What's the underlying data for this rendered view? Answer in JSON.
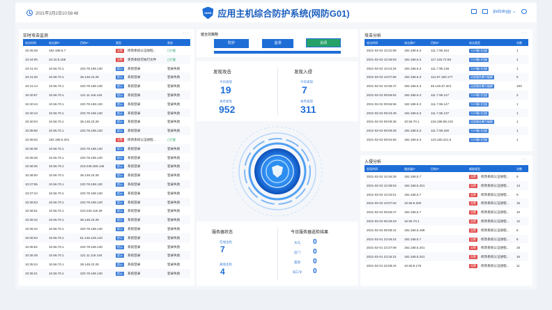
{
  "header": {
    "datetime": "2021年2月2日10:58:48",
    "title": "应用主机综合防护系统(网防G01)",
    "logo_text": "IAMS",
    "user": "jisdzdcyjy"
  },
  "realtime": {
    "title": "实时攻击监测",
    "more": "···",
    "columns": [
      "攻击时间",
      "攻击源IP",
      "目的IP",
      "类型",
      "状态"
    ],
    "rows": [
      {
        "time": "10:45:28",
        "src": "192.168.5.7",
        "dst": "",
        "tag": "告警",
        "tag_color": "red",
        "type": "修改系统认证进程...",
        "status": "已拦截",
        "ok": true
      },
      {
        "time": "10:44:06",
        "src": "10.34.8.156",
        "dst": "",
        "tag": "告警",
        "tag_color": "red",
        "type": "更改系统可执行文件",
        "status": "已拦截",
        "ok": true
      },
      {
        "time": "10:41:44",
        "src": "10.56.70.1",
        "dst": "220.78.169.130",
        "tag": "提示",
        "tag_color": "blue",
        "type": "系统登录",
        "status": "登录失败",
        "ok": false
      },
      {
        "time": "10:41:26",
        "src": "10.56.70.1",
        "dst": "36.148.23.28",
        "tag": "提示",
        "tag_color": "blue",
        "type": "系统登录",
        "status": "登录失败",
        "ok": false
      },
      {
        "time": "10:41:14",
        "src": "10.56.70.1",
        "dst": "220.78.169.130",
        "tag": "提示",
        "tag_color": "blue",
        "type": "系统登录",
        "status": "登录失败",
        "ok": false
      },
      {
        "time": "10:40:57",
        "src": "10.56.70.1",
        "dst": "121.11.116.145",
        "tag": "提示",
        "tag_color": "blue",
        "type": "系统登录",
        "status": "登录失败",
        "ok": false
      },
      {
        "time": "10:40:44",
        "src": "10.56.70.1",
        "dst": "220.78.169.130",
        "tag": "提示",
        "tag_color": "blue",
        "type": "系统登录",
        "status": "登录失败",
        "ok": false
      },
      {
        "time": "10:40:13",
        "src": "10.56.70.1",
        "dst": "220.78.169.130",
        "tag": "提示",
        "tag_color": "blue",
        "type": "系统登录",
        "status": "登录失败",
        "ok": false
      },
      {
        "time": "10:40:04",
        "src": "10.56.70.1",
        "dst": "36.148.23.28",
        "tag": "提示",
        "tag_color": "blue",
        "type": "系统登录",
        "status": "登录失败",
        "ok": false
      },
      {
        "time": "10:38:56",
        "src": "10.56.70.1",
        "dst": "220.78.169.130",
        "tag": "提示",
        "tag_color": "blue",
        "type": "系统登录",
        "status": "登录失败",
        "ok": false
      },
      {
        "time": "10:38:53",
        "src": "192.168.5.201",
        "dst": "",
        "tag": "告警",
        "tag_color": "red",
        "type": "修改系统认证进程...",
        "status": "已拦截",
        "ok": true
      },
      {
        "time": "10:38:35",
        "src": "10.56.70.1",
        "dst": "220.78.169.130",
        "tag": "提示",
        "tag_color": "blue",
        "type": "系统登录",
        "status": "登录失败",
        "ok": false
      },
      {
        "time": "10:38:26",
        "src": "10.56.70.1",
        "dst": "220.78.169.130",
        "tag": "提示",
        "tag_color": "blue",
        "type": "系统登录",
        "status": "登录失败",
        "ok": false
      },
      {
        "time": "10:38:25",
        "src": "10.56.70.1",
        "dst": "219.249.255.146",
        "tag": "提示",
        "tag_color": "blue",
        "type": "系统登录",
        "status": "登录失败",
        "ok": false
      },
      {
        "time": "10:38:00",
        "src": "10.56.70.1",
        "dst": "36.148.23.28",
        "tag": "提示",
        "tag_color": "blue",
        "type": "系统登录",
        "status": "登录失败",
        "ok": false
      },
      {
        "time": "10:37:55",
        "src": "10.56.70.1",
        "dst": "220.78.169.130",
        "tag": "提示",
        "tag_color": "blue",
        "type": "系统登录",
        "status": "登录失败",
        "ok": false
      },
      {
        "time": "10:37:24",
        "src": "10.56.70.1",
        "dst": "220.78.169.130",
        "tag": "提示",
        "tag_color": "blue",
        "type": "系统登录",
        "status": "登录失败",
        "ok": false
      },
      {
        "time": "10:36:53",
        "src": "10.56.70.1",
        "dst": "220.78.169.130",
        "tag": "提示",
        "tag_color": "blue",
        "type": "系统登录",
        "status": "登录失败",
        "ok": false
      },
      {
        "time": "10:36:51",
        "src": "10.56.70.1",
        "dst": "223.240.118.39",
        "tag": "提示",
        "tag_color": "blue",
        "type": "系统登录",
        "status": "登录失败",
        "ok": false
      },
      {
        "time": "10:36:42",
        "src": "10.56.70.1",
        "dst": "36.148.23.28",
        "tag": "提示",
        "tag_color": "blue",
        "type": "系统登录",
        "status": "登录失败",
        "ok": false
      },
      {
        "time": "10:36:22",
        "src": "10.56.70.1",
        "dst": "220.78.169.130",
        "tag": "提示",
        "tag_color": "blue",
        "type": "系统登录",
        "status": "登录失败",
        "ok": false
      },
      {
        "time": "10:36:04",
        "src": "10.56.70.1",
        "dst": "61.145.125.134",
        "tag": "提示",
        "tag_color": "blue",
        "type": "系统登录",
        "status": "登录失败",
        "ok": false
      },
      {
        "time": "10:35:52",
        "src": "10.56.70.1",
        "dst": "220.78.169.130",
        "tag": "提示",
        "tag_color": "blue",
        "type": "系统登录",
        "status": "登录失败",
        "ok": false
      },
      {
        "time": "10:35:49",
        "src": "10.56.70.1",
        "dst": "121.11.116.145",
        "tag": "提示",
        "tag_color": "blue",
        "type": "系统登录",
        "status": "登录失败",
        "ok": false
      },
      {
        "time": "10:35:24",
        "src": "10.56.70.1",
        "dst": "36.148.23.28",
        "tag": "提示",
        "tag_color": "blue",
        "type": "系统登录",
        "status": "登录失败",
        "ok": false
      },
      {
        "time": "10:35:21",
        "src": "10.56.70.1",
        "dst": "220.78.169.130",
        "tag": "提示",
        "tag_color": "blue",
        "type": "系统登录",
        "status": "登录失败",
        "ok": false
      }
    ]
  },
  "strategy": {
    "title": "健全前策略",
    "buttons": [
      "防护",
      "监测",
      "关闭"
    ],
    "active_index": 2
  },
  "discover_attack": {
    "title": "发现攻击",
    "today_label": "今日发现",
    "today": "19",
    "month_label": "本月发现",
    "month": "952"
  },
  "discover_intrusion": {
    "title": "发现入侵",
    "today_label": "今日发现",
    "today": "7",
    "month_label": "本月发现",
    "month": "311"
  },
  "server_status": {
    "title": "服务器状态",
    "online_label": "在线主机",
    "online": "7",
    "offline_label": "离线主机",
    "offline": "4"
  },
  "check_result": {
    "title": "今日服务器巡检结果",
    "items": [
      {
        "label": "木马",
        "value": "0"
      },
      {
        "label": "后门",
        "value": "0"
      },
      {
        "label": "漏洞",
        "value": "0"
      },
      {
        "label": "弱口令",
        "value": "0"
      }
    ]
  },
  "attack_analysis": {
    "title": "攻击分析",
    "more": "···",
    "columns": [
      "攻击时间",
      "攻击源IP",
      "目的IP",
      "攻击类型",
      "次数"
    ],
    "rows": [
      {
        "time": "2021-02-02 10:31:59",
        "src": "192.168.6.3",
        "dst": "111.7.96.164",
        "type": "TCP端口扫描",
        "count": "1"
      },
      {
        "time": "2021-02-02 10:26:53",
        "src": "192.168.6.3",
        "dst": "117.146.72.58",
        "type": "TCP端口扫描",
        "count": "1"
      },
      {
        "time": "2021-02-02 10:24:34",
        "src": "192.168.6.3",
        "dst": "111.7.96.136",
        "type": "TCP端口扫描",
        "count": "1"
      },
      {
        "time": "2021-02-02 10:07:56",
        "src": "192.168.6.3",
        "dst": "114.67.180.177",
        "type": "远程服务暴力破解",
        "count": "6"
      },
      {
        "time": "2021-02-02 10:05:47",
        "src": "192.168.6.3",
        "dst": "45.145.67.201",
        "type": "远程服务暴力破解",
        "count": "193"
      },
      {
        "time": "2021-02-02 09:56:52",
        "src": "192.168.6.3",
        "dst": "111.7.96.147",
        "type": "TCP端口扫描",
        "count": "2"
      },
      {
        "time": "2021-02-02 09:55:56",
        "src": "192.168.6.3",
        "dst": "111.7.96.147",
        "type": "TCP端口扫描",
        "count": "1"
      },
      {
        "time": "2021-02-02 09:43:48",
        "src": "192.168.6.3",
        "dst": "111.7.96.137",
        "type": "TCP端口扫描",
        "count": "1"
      },
      {
        "time": "2021-02-02 09:09:45",
        "src": "10.56.70.1",
        "dst": "218.189.86.210",
        "type": "远程服务暴力破解",
        "count": "1"
      },
      {
        "time": "2021-02-02 09:09:28",
        "src": "192.168.6.3",
        "dst": "111.7.96.150",
        "type": "TCP端口扫描",
        "count": "1"
      },
      {
        "time": "2021-02-02 08:54:55",
        "src": "192.168.6.3",
        "dst": "123.160.221.5",
        "type": "TCP端口扫描",
        "count": "1"
      }
    ]
  },
  "intrusion_analysis": {
    "title": "入侵分析",
    "more": "···",
    "columns": [
      "发现时间",
      "服务器IP",
      "目的IP",
      "威胁类型",
      "次数"
    ],
    "rows": [
      {
        "time": "2021-02-02 10:45:28",
        "src": "192.168.5.7",
        "tag": "告警",
        "type": "修改系统认证进程...",
        "count": "9"
      },
      {
        "time": "2021-02-02 10:38:53",
        "src": "192.168.5.201",
        "tag": "告警",
        "type": "修改系统认证进程...",
        "count": "13"
      },
      {
        "time": "2021-02-02 10:34:01",
        "src": "192.168.5.7",
        "tag": "告警",
        "type": "修改系统认证进程...",
        "count": "9"
      },
      {
        "time": "2021-02-02 10:07:02",
        "src": "10.56.8.200",
        "tag": "告警",
        "type": "修改系统认证进程...",
        "count": "15"
      },
      {
        "time": "2021-02-02 09:55:47",
        "src": "192.168.5.7",
        "tag": "告警",
        "type": "修改系统认证进程...",
        "count": "10"
      },
      {
        "time": "2021-02-02 06:26:18",
        "src": "10.56.70.1",
        "tag": "告警",
        "type": "修改系统认证进程...",
        "count": "12"
      },
      {
        "time": "2021-02-02 05:58:41",
        "src": "192.168.5.198",
        "tag": "告警",
        "type": "修改系统认证进程...",
        "count": "6"
      },
      {
        "time": "2021-02-01 23:46:24",
        "src": "192.168.5.7",
        "tag": "告警",
        "type": "修改系统认证进程...",
        "count": "8"
      },
      {
        "time": "2021-02-01 23:37:09",
        "src": "192.168.5.201",
        "tag": "告警",
        "type": "修改系统认证进程...",
        "count": "18"
      },
      {
        "time": "2021-02-01 23:16:31",
        "src": "192.168.5.201",
        "tag": "告警",
        "type": "修改系统认证进程...",
        "count": "16"
      },
      {
        "time": "2021-02-01 22:58:44",
        "src": "10.56.8.176",
        "tag": "告警",
        "type": "修改系统认证进程...",
        "count": "11"
      }
    ]
  },
  "colors": {
    "accent": "#1e6dd7",
    "alert": "#e14b4b",
    "ok": "#26a269"
  }
}
